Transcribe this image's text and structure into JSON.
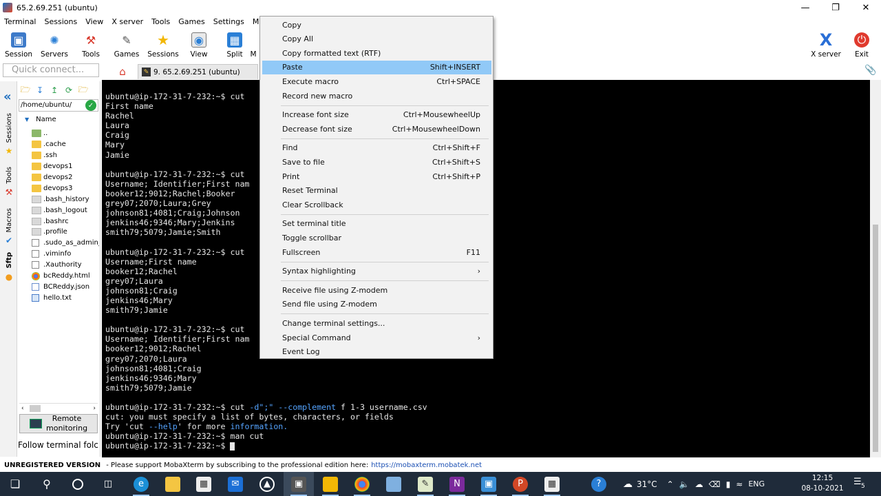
{
  "window": {
    "title": "65.2.69.251 (ubuntu)"
  },
  "menubar": [
    "Terminal",
    "Sessions",
    "View",
    "X server",
    "Tools",
    "Games",
    "Settings",
    "Macros"
  ],
  "toolbar": {
    "session": "Session",
    "servers": "Servers",
    "tools": "Tools",
    "games": "Games",
    "sessions": "Sessions",
    "view": "View",
    "split": "Split",
    "more": "M",
    "xserver": "X server",
    "exit": "Exit"
  },
  "quick_connect": {
    "placeholder": "Quick connect..."
  },
  "tab": {
    "label": "9. 65.2.69.251 (ubuntu)"
  },
  "vtabs": {
    "sessions": "Sessions",
    "tools": "Tools",
    "macros": "Macros",
    "sftp": "Sftp"
  },
  "sftp": {
    "path": "/home/ubuntu/",
    "column": "Name",
    "files": [
      {
        "name": "..",
        "type": "upfolder"
      },
      {
        "name": ".cache",
        "type": "folder"
      },
      {
        "name": ".ssh",
        "type": "folder"
      },
      {
        "name": "devops1",
        "type": "folder"
      },
      {
        "name": "devops2",
        "type": "folder"
      },
      {
        "name": "devops3",
        "type": "folder"
      },
      {
        "name": ".bash_history",
        "type": "file"
      },
      {
        "name": ".bash_logout",
        "type": "file"
      },
      {
        "name": ".bashrc",
        "type": "file"
      },
      {
        "name": ".profile",
        "type": "file"
      },
      {
        "name": ".sudo_as_admin_",
        "type": "doc"
      },
      {
        "name": ".viminfo",
        "type": "doc"
      },
      {
        "name": ".Xauthority",
        "type": "doc"
      },
      {
        "name": "bcReddy.html",
        "type": "chrome"
      },
      {
        "name": "BCReddy.json",
        "type": "json"
      },
      {
        "name": "hello.txt",
        "type": "txt"
      }
    ],
    "remote_monitoring": "Remote\nmonitoring",
    "follow_terminal": "Follow terminal folc"
  },
  "terminal": {
    "lines": [
      [
        "ubuntu@ip-172-31-7-232:~$ cut"
      ],
      [
        "First name"
      ],
      [
        "Rachel"
      ],
      [
        "Laura"
      ],
      [
        "Craig"
      ],
      [
        "Mary"
      ],
      [
        "Jamie"
      ],
      [
        ""
      ],
      [
        "ubuntu@ip-172-31-7-232:~$ cut"
      ],
      [
        "Username; Identifier;First nam"
      ],
      [
        "booker12;9012;Rachel;Booker"
      ],
      [
        "grey07;2070;Laura;Grey"
      ],
      [
        "johnson81;4081;Craig;Johnson"
      ],
      [
        "jenkins46;9346;Mary;Jenkins"
      ],
      [
        "smith79;5079;Jamie;Smith"
      ],
      [
        ""
      ],
      [
        "ubuntu@ip-172-31-7-232:~$ cut"
      ],
      [
        "Username;First name"
      ],
      [
        "booker12;Rachel"
      ],
      [
        "grey07;Laura"
      ],
      [
        "johnson81;Craig"
      ],
      [
        "jenkins46;Mary"
      ],
      [
        "smith79;Jamie"
      ],
      [
        ""
      ],
      [
        "ubuntu@ip-172-31-7-232:~$ cut"
      ],
      [
        "Username; Identifier;First nam"
      ],
      [
        "booker12;9012;Rachel"
      ],
      [
        "grey07;2070;Laura"
      ],
      [
        "johnson81;4081;Craig"
      ],
      [
        "jenkins46;9346;Mary"
      ],
      [
        "smith79;5079;Jamie"
      ],
      [
        ""
      ],
      [
        "ubuntu@ip-172-31-7-232:~$ cut ",
        {
          "hl": "-d\";\" --complement"
        },
        " f 1-3 username.csv"
      ],
      [
        "cut: you must specify a list of bytes, characters, or fields"
      ],
      [
        "Try 'cut ",
        {
          "hl": "--help"
        },
        "' for more ",
        {
          "hl": "information."
        }
      ],
      [
        "ubuntu@ip-172-31-7-232:~$ man cut"
      ],
      [
        "ubuntu@ip-172-31-7-232:~$ ",
        {
          "cursor": true
        }
      ]
    ]
  },
  "context_menu": {
    "items": [
      {
        "label": "Copy",
        "shortcut": ""
      },
      {
        "label": "Copy All",
        "shortcut": ""
      },
      {
        "label": "Copy formatted text (RTF)",
        "shortcut": ""
      },
      {
        "label": "Paste",
        "shortcut": "Shift+INSERT",
        "active": true
      },
      {
        "label": "Execute macro",
        "shortcut": "Ctrl+SPACE"
      },
      {
        "label": "Record new macro",
        "shortcut": ""
      },
      {
        "sep": true
      },
      {
        "label": "Increase font size",
        "shortcut": "Ctrl+MousewheelUp"
      },
      {
        "label": "Decrease font size",
        "shortcut": "Ctrl+MousewheelDown"
      },
      {
        "sep": true
      },
      {
        "label": "Find",
        "shortcut": "Ctrl+Shift+F"
      },
      {
        "label": "Save to file",
        "shortcut": "Ctrl+Shift+S"
      },
      {
        "label": "Print",
        "shortcut": "Ctrl+Shift+P"
      },
      {
        "label": "Reset Terminal",
        "shortcut": ""
      },
      {
        "label": "Clear Scrollback",
        "shortcut": ""
      },
      {
        "sep": true
      },
      {
        "label": "Set terminal title",
        "shortcut": ""
      },
      {
        "label": "Toggle scrollbar",
        "shortcut": ""
      },
      {
        "label": "Fullscreen",
        "shortcut": "F11"
      },
      {
        "sep": true
      },
      {
        "label": "Syntax highlighting",
        "shortcut": "›"
      },
      {
        "sep": true
      },
      {
        "label": "Receive file using Z-modem",
        "shortcut": ""
      },
      {
        "label": "Send file using Z-modem",
        "shortcut": ""
      },
      {
        "sep": true
      },
      {
        "label": "Change terminal settings...",
        "shortcut": ""
      },
      {
        "label": "Special Command",
        "shortcut": "›"
      },
      {
        "label": "Event Log",
        "shortcut": ""
      }
    ]
  },
  "statusbar": {
    "unregistered": "UNREGISTERED VERSION",
    "message": "-  Please support MobaXterm by subscribing to the professional edition here:",
    "link": "https://mobaxterm.mobatek.net"
  },
  "taskbar": {
    "weather": "31°C",
    "language": "ENG",
    "time": "12:15",
    "date": "08-10-2021",
    "notifications": "5"
  }
}
